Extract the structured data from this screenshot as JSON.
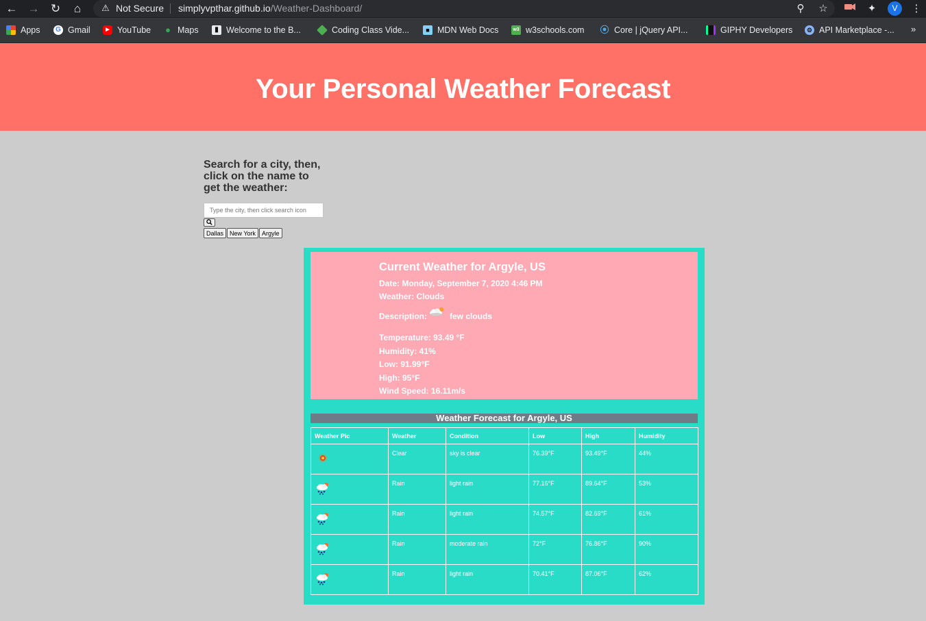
{
  "browser": {
    "security_label": "Not Secure",
    "url_host": "simplyvpthar.github.io",
    "url_path": "/Weather-Dashboard/",
    "profile_initial": "V",
    "bookmarks": [
      {
        "label": "Apps",
        "icon": "apps-grid-icon",
        "color": "#e94235"
      },
      {
        "label": "Gmail",
        "icon": "google-icon",
        "color": "#4285f4"
      },
      {
        "label": "YouTube",
        "icon": "youtube-icon",
        "color": "#ff0000"
      },
      {
        "label": "Maps",
        "icon": "maps-pin-icon",
        "color": "#34a853"
      },
      {
        "label": "Welcome to the B...",
        "icon": "book-icon",
        "color": "#111111"
      },
      {
        "label": "Coding Class Vide...",
        "icon": "cube-icon",
        "color": "#4caf50"
      },
      {
        "label": "MDN Web Docs",
        "icon": "mdn-icon",
        "color": "#83d0f2"
      },
      {
        "label": "w3schools.com",
        "icon": "w3schools-icon",
        "color": "#4caf50"
      },
      {
        "label": "Core | jQuery API...",
        "icon": "jquery-icon",
        "color": "#0769ad"
      },
      {
        "label": "GIPHY Developers",
        "icon": "giphy-icon",
        "color": "#00ff99"
      },
      {
        "label": "API Marketplace -...",
        "icon": "api-marketplace-icon",
        "color": "#8ab4f8"
      }
    ]
  },
  "header": {
    "title": "Your Personal Weather Forecast"
  },
  "search": {
    "heading": "Search for a city, then, click on the name to get the weather:",
    "placeholder": "Type the city, then click search icon",
    "history": [
      "Dallas",
      "New York",
      "Argyle"
    ]
  },
  "current": {
    "title": "Current Weather for Argyle, US",
    "date": "Date: Monday, September 7, 2020 4:46 PM",
    "weather": "Weather: Clouds",
    "description_label": "Description:",
    "description": "few clouds",
    "temperature": "Temperature: 93.49 °F",
    "humidity": "Humidity: 41%",
    "low": "Low: 91.99°F",
    "high": "High: 95°F",
    "wind": "Wind Speed: 16.11m/s"
  },
  "forecast": {
    "title": "Weather Forecast for Argyle, US",
    "columns": [
      "Weather Pic",
      "Weather",
      "Condition",
      "Low",
      "High",
      "Humidity"
    ],
    "rows": [
      {
        "icon": "sun-icon",
        "weather": "Clear",
        "condition": "sky is clear",
        "low": "76.39°F",
        "high": "93.49°F",
        "humidity": "44%"
      },
      {
        "icon": "rain-icon",
        "weather": "Rain",
        "condition": "light rain",
        "low": "77.16°F",
        "high": "89.64°F",
        "humidity": "53%"
      },
      {
        "icon": "rain-icon",
        "weather": "Rain",
        "condition": "light rain",
        "low": "74.57°F",
        "high": "82.69°F",
        "humidity": "61%"
      },
      {
        "icon": "rain-icon",
        "weather": "Rain",
        "condition": "moderate rain",
        "low": "72°F",
        "high": "76.86°F",
        "humidity": "90%"
      },
      {
        "icon": "rain-icon",
        "weather": "Rain",
        "condition": "light rain",
        "low": "70.41°F",
        "high": "87.06°F",
        "humidity": "62%"
      }
    ]
  },
  "colors": {
    "hero": "#ff7066",
    "panel": "#29dcc8",
    "current_card": "#ffa9b5",
    "forecast_title_bar": "#6f7b86",
    "page_bg": "#cccccc"
  }
}
